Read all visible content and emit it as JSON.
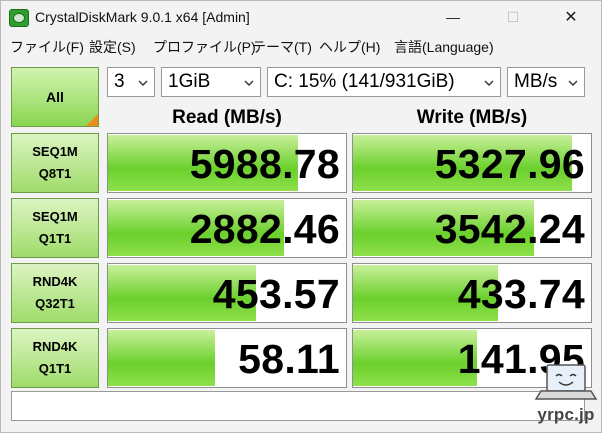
{
  "window": {
    "title": "CrystalDiskMark 9.0.1 x64 [Admin]",
    "min_glyph": "—",
    "max_glyph": "☐",
    "close_glyph": "✕",
    "icon": "crystaldiskmark-app-icon"
  },
  "menu": [
    "ファイル(F)",
    "設定(S)",
    "プロファイル(P)",
    "テーマ(T)",
    "ヘルプ(H)",
    "言語(Language)"
  ],
  "controls": {
    "all_label": "All",
    "count": "3",
    "size": "1GiB",
    "drive": "C: 15% (141/931GiB)",
    "unit": "MB/s"
  },
  "headers": {
    "read": "Read (MB/s)",
    "write": "Write (MB/s)"
  },
  "tests": [
    {
      "line1": "SEQ1M",
      "line2": "Q8T1",
      "read": "5988.78",
      "write": "5327.96",
      "read_fill": 0.8,
      "write_fill": 0.92
    },
    {
      "line1": "SEQ1M",
      "line2": "Q1T1",
      "read": "2882.46",
      "write": "3542.24",
      "read_fill": 0.74,
      "write_fill": 0.76
    },
    {
      "line1": "RND4K",
      "line2": "Q32T1",
      "read": "453.57",
      "write": "433.74",
      "read_fill": 0.62,
      "write_fill": 0.61
    },
    {
      "line1": "RND4K",
      "line2": "Q1T1",
      "read": "58.11",
      "write": "141.95",
      "read_fill": 0.45,
      "write_fill": 0.52
    }
  ],
  "comment": "",
  "watermark": "yrpc.jp",
  "colors": {
    "bar_green": "#6bd02c",
    "button_green": "#9fdc6b",
    "corner_orange": "#ef8a1c"
  }
}
